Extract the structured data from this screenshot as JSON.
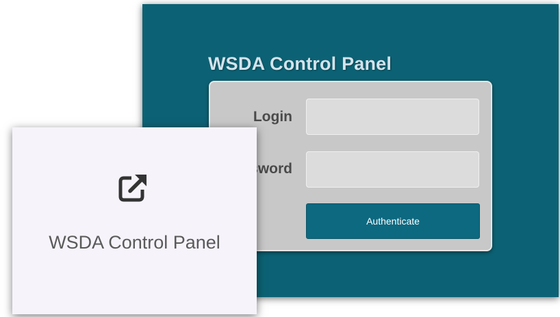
{
  "login_screen": {
    "title": "WSDA Control Panel",
    "background_color": "#0c6274",
    "fields": {
      "login_label": "Login",
      "login_value": "",
      "password_label": "Password",
      "password_value": ""
    },
    "authenticate_label": "Authenticate",
    "button_color": "#0c6980"
  },
  "card": {
    "icon": "external-link-icon",
    "label": "WSDA Control Panel",
    "background_color": "#f6f3fa"
  }
}
